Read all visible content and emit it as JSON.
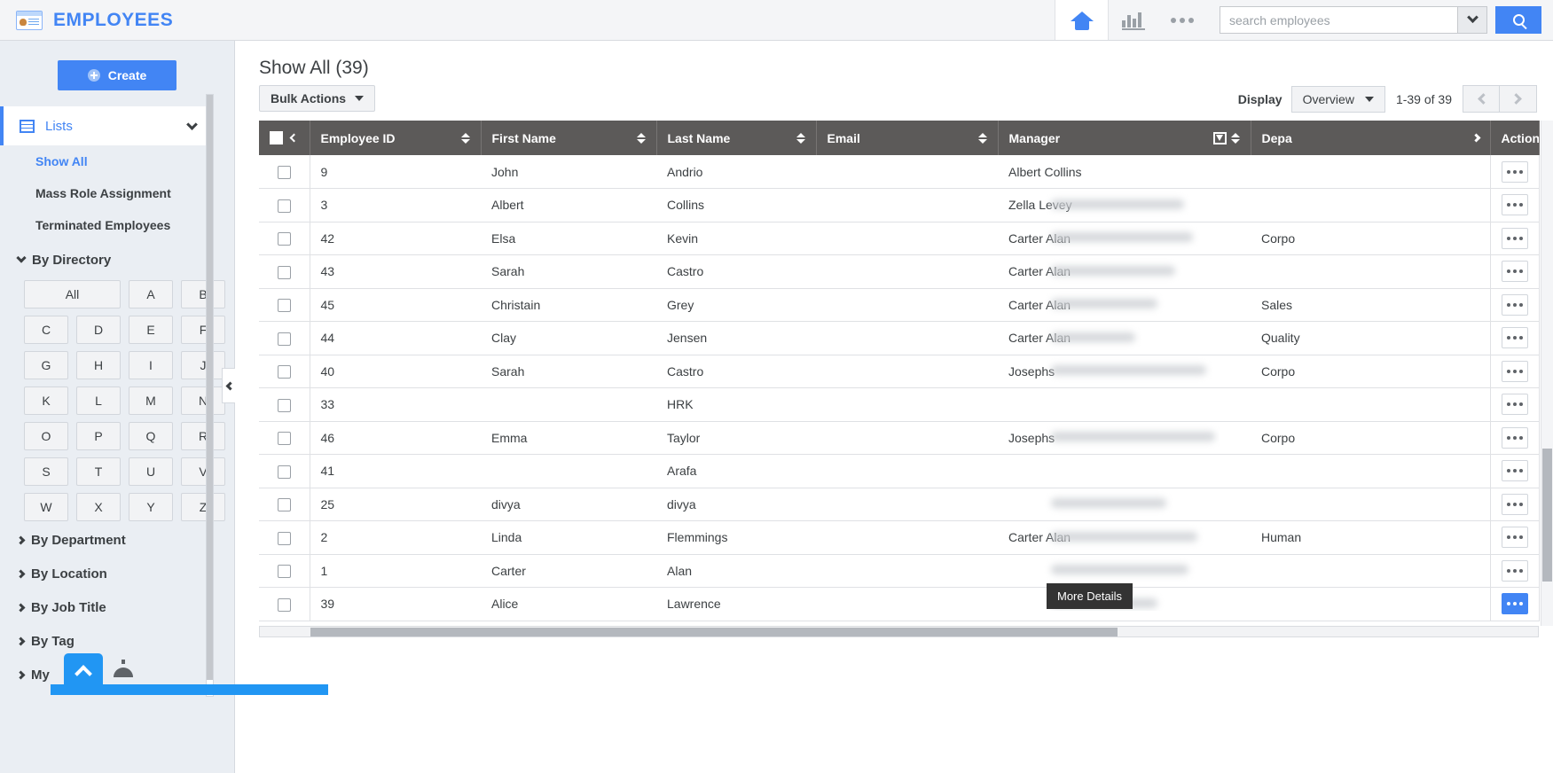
{
  "topbar": {
    "app_icon": "id-card-icon",
    "app_title": "EMPLOYEES",
    "home_icon": "home-icon",
    "reports_icon": "bar-chart-icon",
    "more_icon": "more-horizontal-icon",
    "search_placeholder": "search employees",
    "search_value": "",
    "search_dropdown_icon": "chevron-down-icon",
    "search_button_icon": "search-icon",
    "accent_color": "#4285f4"
  },
  "sidebar": {
    "create_label": "Create",
    "create_icon": "plus-circle-icon",
    "lists_label": "Lists",
    "lists_icon": "grid-icon",
    "lists_chevron": "chevron-down-icon",
    "links": [
      {
        "label": "Show All",
        "active": true
      },
      {
        "label": "Mass Role Assignment",
        "active": false
      },
      {
        "label": "Terminated Employees",
        "active": false
      }
    ],
    "directory_label": "By Directory",
    "directory_letters": [
      "All",
      "A",
      "B",
      "C",
      "D",
      "E",
      "F",
      "G",
      "H",
      "I",
      "J",
      "K",
      "L",
      "M",
      "N",
      "O",
      "P",
      "Q",
      "R",
      "S",
      "T",
      "U",
      "V",
      "W",
      "X",
      "Y",
      "Z"
    ],
    "groups": [
      {
        "label": "By Department"
      },
      {
        "label": "By Location"
      },
      {
        "label": "By Job Title"
      },
      {
        "label": "By Tag"
      },
      {
        "label": "My"
      }
    ],
    "collapse_handle_icon": "chevron-left-icon",
    "scroll_to_top_icon": "chevron-up-icon",
    "chat_icon": "chat-bubble-icon"
  },
  "main": {
    "page_title": "Show All (39)",
    "bulk_actions_label": "Bulk Actions",
    "bulk_actions_icon": "caret-down-icon",
    "display_label": "Display",
    "display_value": "Overview",
    "display_icon": "caret-down-icon",
    "page_count": "1-39 of 39",
    "prev_icon": "chevron-left-icon",
    "next_icon": "chevron-right-icon"
  },
  "table": {
    "columns": [
      {
        "label": "Employee ID",
        "sortable": true,
        "filter": false
      },
      {
        "label": "First Name",
        "sortable": true,
        "filter": false
      },
      {
        "label": "Last Name",
        "sortable": true,
        "filter": false
      },
      {
        "label": "Email",
        "sortable": true,
        "filter": false
      },
      {
        "label": "Manager",
        "sortable": true,
        "filter": true
      },
      {
        "label": "Depa",
        "sortable": true,
        "filter": true
      },
      {
        "label": "Actions",
        "sortable": false,
        "filter": false
      }
    ],
    "select_all_icon": "checkbox-icon",
    "header_collapse_icon": "chevron-left-icon",
    "actions_expand_icon": "chevron-right-icon",
    "row_action_icon": "more-horizontal-icon",
    "rows": [
      {
        "id": "9",
        "first": "John",
        "last": "Andrio",
        "email": "",
        "manager": "Albert Collins",
        "dept": ""
      },
      {
        "id": "3",
        "first": "Albert",
        "last": "Collins",
        "email": "",
        "manager": "Zella Levey",
        "dept": ""
      },
      {
        "id": "42",
        "first": "Elsa",
        "last": "Kevin",
        "email": "",
        "manager": "Carter Alan",
        "dept": "Corpo"
      },
      {
        "id": "43",
        "first": "Sarah",
        "last": "Castro",
        "email": "",
        "manager": "Carter Alan",
        "dept": ""
      },
      {
        "id": "45",
        "first": "Christain",
        "last": "Grey",
        "email": "",
        "manager": "Carter Alan",
        "dept": "Sales"
      },
      {
        "id": "44",
        "first": "Clay",
        "last": "Jensen",
        "email": "",
        "manager": "Carter Alan",
        "dept": "Quality"
      },
      {
        "id": "40",
        "first": "Sarah",
        "last": "Castro",
        "email": "",
        "manager": "Josephs",
        "dept": "Corpo"
      },
      {
        "id": "33",
        "first": "",
        "last": "HRK",
        "email": "",
        "manager": "",
        "dept": ""
      },
      {
        "id": "46",
        "first": "Emma",
        "last": "Taylor",
        "email": "",
        "manager": "Josephs",
        "dept": "Corpo"
      },
      {
        "id": "41",
        "first": "",
        "last": "Arafa",
        "email": "",
        "manager": "",
        "dept": ""
      },
      {
        "id": "25",
        "first": "divya",
        "last": "divya",
        "email": "",
        "manager": "",
        "dept": ""
      },
      {
        "id": "2",
        "first": "Linda",
        "last": "Flemmings",
        "email": "",
        "manager": "Carter Alan",
        "dept": "Human"
      },
      {
        "id": "1",
        "first": "Carter",
        "last": "Alan",
        "email": "",
        "manager": "",
        "dept": ""
      },
      {
        "id": "39",
        "first": "Alice",
        "last": "Lawrence",
        "email": "",
        "manager": "",
        "dept": ""
      }
    ],
    "highlighted_row_index": 13
  },
  "tooltip": {
    "text": "More Details"
  }
}
